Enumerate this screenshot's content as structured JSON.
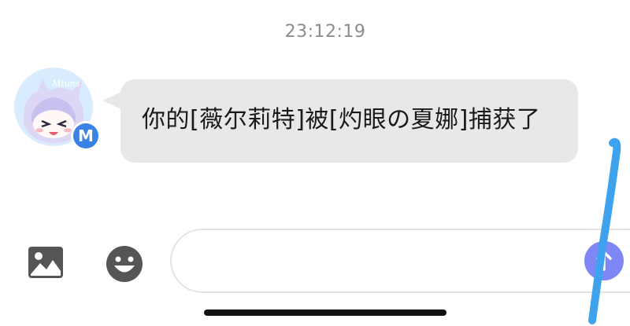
{
  "chat": {
    "timestamp": "23:12:19",
    "messages": [
      {
        "sender_avatar": "anime-character-avatar",
        "sender_badge": "M",
        "text": "你的[薇尔莉特]被[灼眼の夏娜]捕获了"
      }
    ]
  },
  "avatar_text": "Mtuns",
  "input_bar": {
    "image_icon": "image-icon",
    "emoji_icon": "emoji-icon",
    "message_value": "",
    "send_icon": "send-arrow-icon"
  },
  "colors": {
    "bubble": "#e8e8e8",
    "badge": "#3b82e6",
    "send_button": "#7f86f5",
    "scribble": "#3fa2ee"
  }
}
